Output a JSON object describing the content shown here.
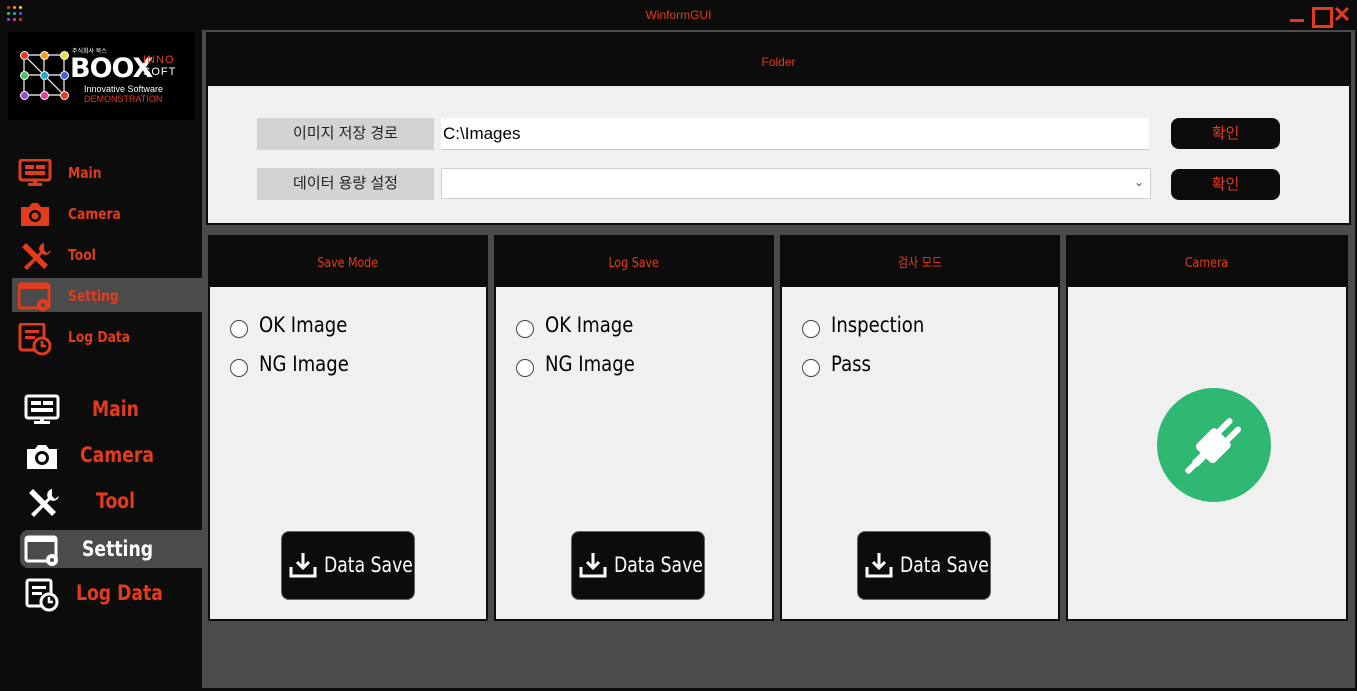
{
  "window": {
    "title": "WinformGUI",
    "close_glyph": "✕"
  },
  "logo": {
    "korean_name": "주식회사 북스",
    "brand": "BOOX",
    "inno": "INNO",
    "soft": "SOFT",
    "tagline": "Innovative Software",
    "demo": "DEMONSTRATION"
  },
  "nav_primary": [
    {
      "label": "Main",
      "icon": "monitor-icon"
    },
    {
      "label": "Camera",
      "icon": "camera-icon"
    },
    {
      "label": "Tool",
      "icon": "tools-icon"
    },
    {
      "label": "Setting",
      "icon": "settings-window-icon",
      "selected": true
    },
    {
      "label": "Log Data",
      "icon": "log-data-icon"
    }
  ],
  "nav_secondary": [
    {
      "label": "Main",
      "icon": "monitor-icon"
    },
    {
      "label": "Camera",
      "icon": "camera-icon"
    },
    {
      "label": "Tool",
      "icon": "tools-icon"
    },
    {
      "label": "Setting",
      "icon": "settings-window-icon",
      "selected": true
    },
    {
      "label": "Log Data",
      "icon": "log-data-icon"
    }
  ],
  "folder": {
    "header": "Folder",
    "image_path_label": "이미지 저장 경로",
    "image_path_value": "C:\\Images",
    "capacity_label": "데이터 용량 설정",
    "capacity_value": "",
    "confirm_label": "확인",
    "chevron": "⌄"
  },
  "panels": [
    {
      "title": "Save Mode",
      "options": [
        "OK Image",
        "NG Image"
      ],
      "button": "Data Save"
    },
    {
      "title": "Log Save",
      "options": [
        "OK Image",
        "NG Image"
      ],
      "button": "Data Save"
    },
    {
      "title": "검사 모드",
      "options": [
        "Inspection",
        "Pass"
      ],
      "button": "Data Save"
    },
    {
      "title": "Camera",
      "icon": "plug-icon",
      "status_color": "#2eb872"
    }
  ],
  "colors": {
    "accent": "#e23b1e",
    "background": "#0c0c0c",
    "panel": "#f0f0f0",
    "selected": "#4b4b4b"
  }
}
